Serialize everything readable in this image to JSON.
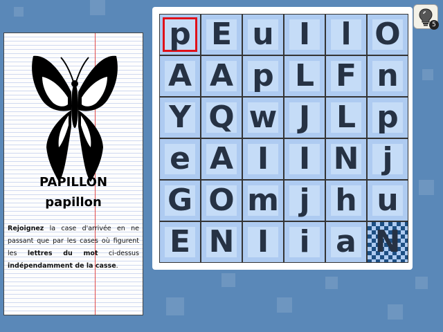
{
  "word": {
    "uppercase": "PAPILLON",
    "lowercase": "papillon"
  },
  "instruction": {
    "part1_bold": "Rejoignez",
    "part2": " la case d'arrivée en ne passant que par les cases où figurent les ",
    "part3_bold": "lettres du mot",
    "part4": " ci-dessus ",
    "part5_bold": "indépendamment de la casse",
    "part6": "."
  },
  "grid": {
    "rows": [
      [
        "p",
        "E",
        "u",
        "I",
        "l",
        "O"
      ],
      [
        "A",
        "A",
        "p",
        "L",
        "F",
        "n"
      ],
      [
        "Y",
        "Q",
        "w",
        "J",
        "L",
        "p"
      ],
      [
        "e",
        "A",
        "I",
        "I",
        "N",
        "j"
      ],
      [
        "G",
        "O",
        "m",
        "j",
        "h",
        "u"
      ],
      [
        "E",
        "N",
        "I",
        "i",
        "a",
        "N"
      ]
    ],
    "start": "p",
    "finish": "N"
  },
  "hint": {
    "icon": "lightbulb-icon",
    "count": "5"
  },
  "colors": {
    "background": "#5a88b8",
    "cell": "#aecbf1",
    "start_outline": "#e0101a",
    "finish_checker": "#1d4f83"
  }
}
